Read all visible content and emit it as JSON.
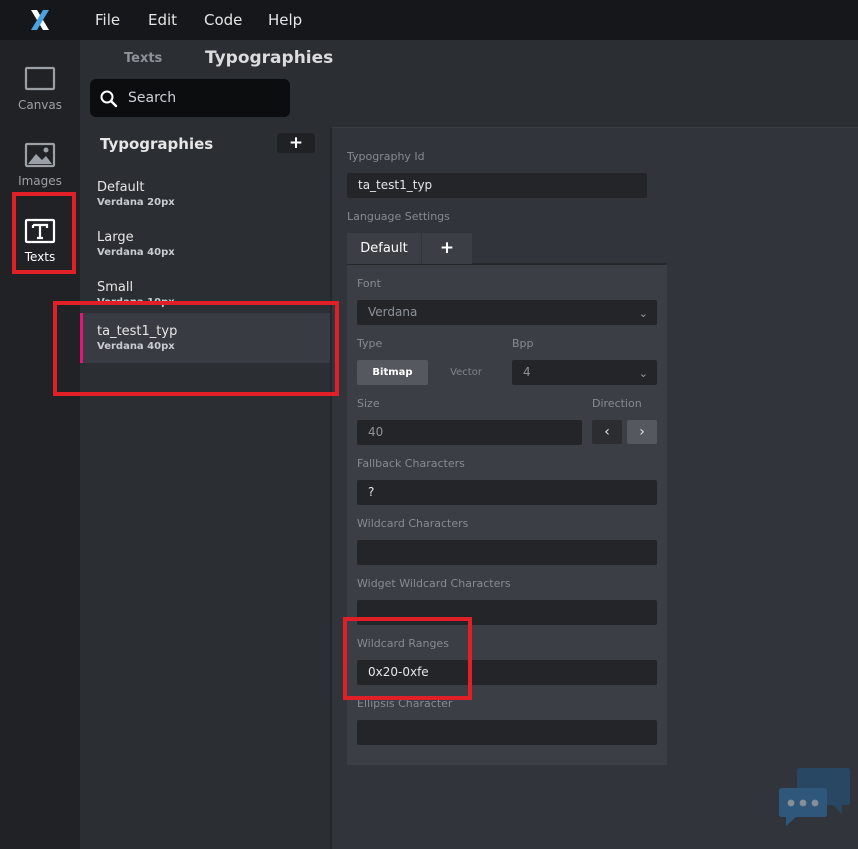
{
  "menubar": {
    "logo": "X",
    "items": [
      {
        "label": "File"
      },
      {
        "label": "Edit"
      },
      {
        "label": "Code"
      },
      {
        "label": "Help"
      }
    ]
  },
  "rail": {
    "items": [
      {
        "label": "Canvas",
        "icon": "canvas-icon"
      },
      {
        "label": "Images",
        "icon": "image-icon"
      },
      {
        "label": "Texts",
        "icon": "text-icon"
      }
    ]
  },
  "header": {
    "tab_texts": "Texts",
    "tab_typographies": "Typographies",
    "search_placeholder": "Search"
  },
  "list": {
    "title": "Typographies",
    "add_label": "+",
    "items": [
      {
        "name": "Default",
        "sub": "Verdana 20px"
      },
      {
        "name": "Large",
        "sub": "Verdana 40px"
      },
      {
        "name": "Small",
        "sub": "Verdana 10px"
      },
      {
        "name": "ta_test1_typ",
        "sub": "Verdana 40px"
      }
    ]
  },
  "detail": {
    "typography_id_label": "Typography Id",
    "typography_id_value": "ta_test1_typ",
    "language_settings_label": "Language Settings",
    "lang_tab_default": "Default",
    "lang_tab_add": "+",
    "font_label": "Font",
    "font_value": "Verdana",
    "type_label": "Type",
    "type_bitmap": "Bitmap",
    "type_vector": "Vector",
    "bpp_label": "Bpp",
    "bpp_value": "4",
    "size_label": "Size",
    "size_value": "40",
    "direction_label": "Direction",
    "dir_left": "‹",
    "dir_right": "›",
    "fallback_label": "Fallback Characters",
    "fallback_value": "?",
    "wildcard_label": "Wildcard Characters",
    "wildcard_value": "",
    "widget_wildcard_label": "Widget Wildcard Characters",
    "widget_wildcard_value": "",
    "wildcard_ranges_label": "Wildcard Ranges",
    "wildcard_ranges_value": "0x20-0xfe",
    "ellipsis_label": "Ellipsis Character",
    "ellipsis_value": ""
  },
  "colors": {
    "accent_selected": "#e0177a",
    "annotation_red": "#e01f26",
    "logo_blue": "#4aa3df"
  }
}
